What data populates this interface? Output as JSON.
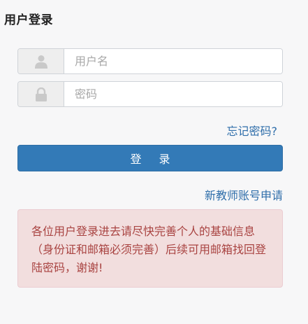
{
  "page": {
    "title": "用户登录"
  },
  "form": {
    "username_placeholder": "用户名",
    "username_value": "",
    "username_icon": "user-icon",
    "password_placeholder": "密码",
    "password_value": "",
    "password_icon": "lock-icon",
    "forgot_link": "忘记密码?",
    "login_button": "登 录",
    "register_link": "新教师账号申请"
  },
  "notice": {
    "text": "各位用户登录进去请尽快完善个人的基础信息（身份证和邮箱必须完善）后续可用邮箱找回登陆密码，谢谢!"
  },
  "colors": {
    "primary": "#337ab7",
    "link": "#2f6eaa",
    "alert_bg": "#f2dede",
    "alert_text": "#a94442"
  }
}
